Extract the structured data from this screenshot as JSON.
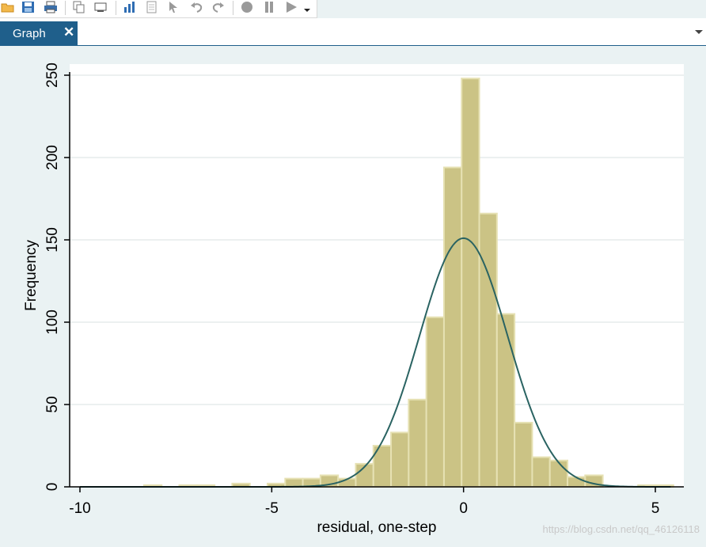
{
  "toolbar": {
    "items": [
      "open-icon",
      "save-icon",
      "print-icon",
      "copy-icon",
      "graph-window-icon",
      "graph-editor-icon",
      "data-editor-icon",
      "pointer-icon",
      "undo-icon",
      "redo-icon",
      "record-icon",
      "pause-icon",
      "play-icon",
      "dropdown-icon"
    ]
  },
  "tab": {
    "label": "Graph",
    "close_glyph": "✕"
  },
  "watermark": "https://blog.csdn.net/qq_46126118",
  "colors": {
    "bar_fill": "#cbc385",
    "bar_edge": "#e6e1b3",
    "curve": "#2a6362",
    "grid": "#e5ecec",
    "tab": "#1f5f8b"
  },
  "chart_data": {
    "type": "bar",
    "subtype": "histogram with normal density overlay",
    "xlabel": "residual, one-step",
    "ylabel": "Frequency",
    "xlim": [
      -10.3,
      5.7
    ],
    "ylim": [
      0,
      256
    ],
    "xticks": [
      -10,
      -5,
      0,
      5
    ],
    "xtick_labels": [
      "-10",
      "-5",
      "0",
      "5"
    ],
    "yticks": [
      0,
      50,
      100,
      150,
      200,
      250
    ],
    "ytick_labels": [
      "0",
      "50",
      "100",
      "150",
      "200",
      "250"
    ],
    "grid": "horizontal",
    "bin_width": 0.46,
    "bins": [
      {
        "x0": -8.33,
        "count": 1
      },
      {
        "x0": -7.41,
        "count": 1
      },
      {
        "x0": -6.95,
        "count": 1
      },
      {
        "x0": -6.03,
        "count": 2
      },
      {
        "x0": -5.11,
        "count": 2
      },
      {
        "x0": -4.65,
        "count": 5
      },
      {
        "x0": -4.19,
        "count": 5
      },
      {
        "x0": -3.73,
        "count": 7
      },
      {
        "x0": -3.27,
        "count": 5
      },
      {
        "x0": -2.81,
        "count": 14
      },
      {
        "x0": -2.35,
        "count": 25
      },
      {
        "x0": -1.89,
        "count": 33
      },
      {
        "x0": -1.43,
        "count": 53
      },
      {
        "x0": -0.97,
        "count": 103
      },
      {
        "x0": -0.51,
        "count": 194
      },
      {
        "x0": -0.05,
        "count": 248
      },
      {
        "x0": 0.41,
        "count": 166
      },
      {
        "x0": 0.87,
        "count": 105
      },
      {
        "x0": 1.33,
        "count": 39
      },
      {
        "x0": 1.79,
        "count": 18
      },
      {
        "x0": 2.25,
        "count": 16
      },
      {
        "x0": 2.71,
        "count": 6
      },
      {
        "x0": 3.17,
        "count": 7
      },
      {
        "x0": 4.55,
        "count": 1
      },
      {
        "x0": 5.01,
        "count": 1
      }
    ],
    "normal_curve": {
      "mean": 0.0,
      "sd": 1.15,
      "peak": 151
    }
  }
}
